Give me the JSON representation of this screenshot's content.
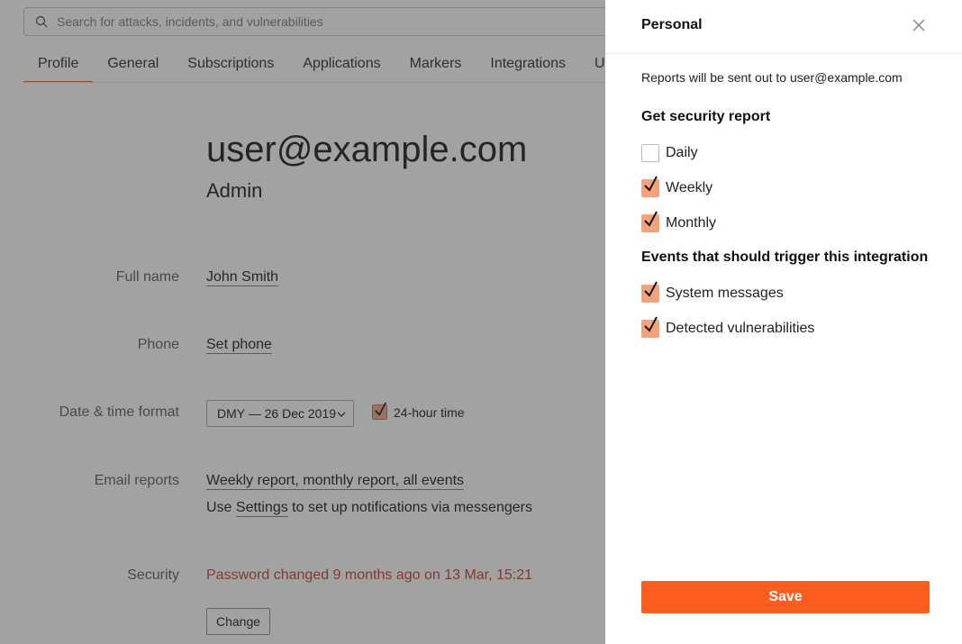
{
  "search": {
    "placeholder": "Search for attacks, incidents, and vulnerabilities"
  },
  "tabs": [
    {
      "label": "Profile",
      "active": true
    },
    {
      "label": "General"
    },
    {
      "label": "Subscriptions"
    },
    {
      "label": "Applications"
    },
    {
      "label": "Markers"
    },
    {
      "label": "Integrations"
    },
    {
      "label": "U"
    }
  ],
  "profile": {
    "email": "user@example.com",
    "role": "Admin",
    "full_name_label": "Full name",
    "full_name": "John Smith",
    "phone_label": "Phone",
    "phone_value": "Set phone",
    "datetime_label": "Date & time format",
    "datetime_value": "DMY — 26 Dec 2019",
    "hour24_label": "24-hour time",
    "hour24_checked": true,
    "email_reports_label": "Email reports",
    "email_reports_value": "Weekly report, monthly report, all events",
    "settings_prefix": "Use",
    "settings_link": "Settings",
    "settings_suffix": "to set up notifications via messengers",
    "security_label": "Security",
    "security_prefix": "Password changed",
    "security_time": "9 months ago",
    "security_suffix": "on 13 Mar, 15:21",
    "change_button": "Change"
  },
  "panel": {
    "title": "Personal",
    "info": "Reports will be sent out to user@example.com",
    "report_section": "Get security report",
    "report_options": [
      {
        "label": "Daily",
        "checked": false
      },
      {
        "label": "Weekly",
        "checked": true
      },
      {
        "label": "Monthly",
        "checked": true
      }
    ],
    "events_section": "Events that should trigger this integration",
    "event_options": [
      {
        "label": "System messages",
        "checked": true
      },
      {
        "label": "Detected vulnerabilities",
        "checked": true
      }
    ],
    "save_button": "Save"
  },
  "colors": {
    "accent": "#ff5d1f",
    "checkbox_fill": "#f3a27e",
    "tab_underline": "#d9612a",
    "security_text": "#c0392b"
  },
  "icons": {
    "search": "search-icon",
    "close": "close-icon",
    "chevron": "chevron-down-icon",
    "check": "check-icon"
  }
}
